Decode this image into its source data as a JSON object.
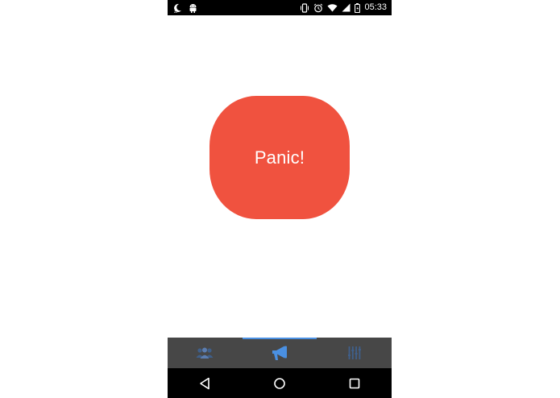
{
  "status_bar": {
    "time": "05:33",
    "icons": [
      "moon-icon",
      "android-icon",
      "vibrate-icon",
      "alarm-icon",
      "wifi-icon",
      "signal-icon",
      "battery-icon"
    ]
  },
  "main": {
    "panic_label": "Panic!",
    "panic_color": "#f0523f"
  },
  "tabs": [
    {
      "icon": "contacts-icon",
      "selected": false
    },
    {
      "icon": "megaphone-icon",
      "selected": true
    },
    {
      "icon": "settings-sliders-icon",
      "selected": false
    }
  ],
  "nav_bar": {
    "buttons": [
      "back-icon",
      "home-icon",
      "recents-icon"
    ]
  },
  "colors": {
    "accent": "#4a90e2",
    "tab_bar_bg": "#474747",
    "icon_inactive": "#3f5f8a"
  }
}
